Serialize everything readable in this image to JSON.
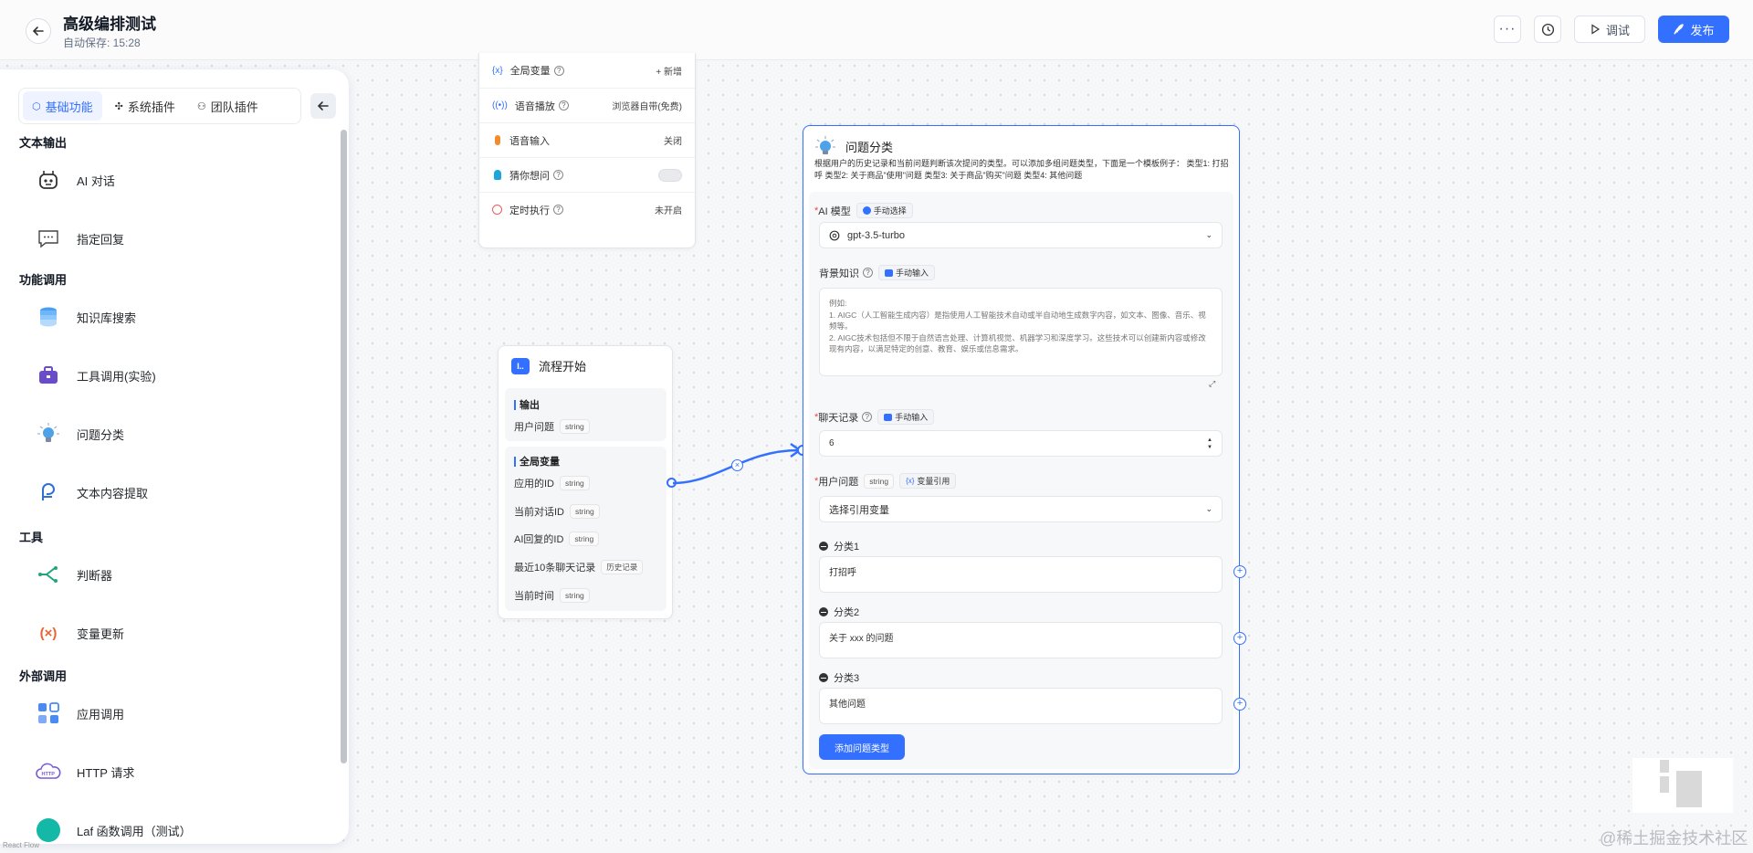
{
  "header": {
    "title": "高级编排测试",
    "autosave": "自动保存: 15:28",
    "debug_label": "调试",
    "publish_label": "发布"
  },
  "left_panel": {
    "tabs": [
      {
        "label": "基础功能",
        "active": true
      },
      {
        "label": "系统插件",
        "active": false
      },
      {
        "label": "团队插件",
        "active": false
      }
    ],
    "sections": {
      "text_output": "文本输出",
      "function_call": "功能调用",
      "tools": "工具",
      "external_call": "外部调用"
    },
    "modules": {
      "ai_chat": "AI 对话",
      "reply": "指定回复",
      "kb_search": "知识库搜索",
      "tool_call": "工具调用(实验)",
      "classify": "问题分类",
      "extract": "文本内容提取",
      "judge": "判断器",
      "var_update": "变量更新",
      "app_call": "应用调用",
      "http": "HTTP 请求",
      "laf": "Laf 函数调用（测试）"
    }
  },
  "settings_node": {
    "rows": [
      {
        "label": "全局变量",
        "value": "+ 新增"
      },
      {
        "label": "语音播放",
        "value": "浏览器自带(免费)"
      },
      {
        "label": "语音输入",
        "value": "关闭"
      },
      {
        "label": "猜你想问",
        "value": ""
      },
      {
        "label": "定时执行",
        "value": "未开启"
      }
    ]
  },
  "start_node": {
    "title": "流程开始",
    "output_label": "输出",
    "output_field": {
      "name": "用户问题",
      "type": "string"
    },
    "global_label": "全局变量",
    "global_fields": [
      {
        "name": "应用的ID",
        "type": "string"
      },
      {
        "name": "当前对话ID",
        "type": "string"
      },
      {
        "name": "AI回复的ID",
        "type": "string"
      },
      {
        "name": "最近10条聊天记录",
        "type": "历史记录"
      },
      {
        "name": "当前时间",
        "type": "string"
      }
    ]
  },
  "classify_node": {
    "title": "问题分类",
    "description": "根据用户的历史记录和当前问题判断该次提问的类型。可以添加多组问题类型，下面是一个模板例子： 类型1: 打招呼 类型2: 关于商品\"使用\"问题 类型3: 关于商品\"购买\"问题 类型4: 其他问题",
    "ai_model_label": "AI 模型",
    "ai_model_tag": "手动选择",
    "ai_model_value": "gpt-3.5-turbo",
    "background_label": "背景知识",
    "background_tag": "手动输入",
    "background_placeholder": "例如:\n1. AIGC（人工智能生成内容）是指使用人工智能技术自动或半自动地生成数字内容，如文本、图像、音乐、视频等。\n2. AIGC技术包括但不限于自然语言处理、计算机视觉、机器学习和深度学习。这些技术可以创建新内容或修改现有内容，以满足特定的创意、教育、娱乐或信息需求。",
    "history_label": "聊天记录",
    "history_tag": "手动输入",
    "history_value": "6",
    "question_label": "用户问题",
    "question_type": "string",
    "question_tag": "变量引用",
    "question_select": "选择引用变量",
    "categories": [
      {
        "label": "分类1",
        "value": "打招呼"
      },
      {
        "label": "分类2",
        "value": "关于 xxx 的问题"
      },
      {
        "label": "分类3",
        "value": "其他问题"
      }
    ],
    "add_button": "添加问题类型"
  },
  "footer": {
    "react_flow": "React Flow",
    "watermark": "@稀土掘金技术社区"
  },
  "colors": {
    "accent": "#3370ff",
    "canvas": "#f6f7f9"
  }
}
